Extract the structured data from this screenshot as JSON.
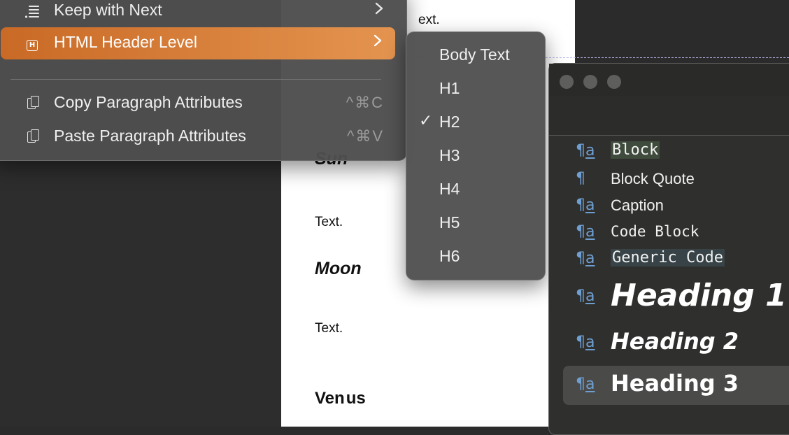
{
  "menu": {
    "items": [
      {
        "label": "Keep with Next",
        "icon": "paragraph-lines-icon",
        "has_submenu": true
      },
      {
        "label": "HTML Header Level",
        "icon": "h-badge-icon",
        "has_submenu": true,
        "highlighted": true
      },
      {
        "label": "Copy Paragraph Attributes",
        "icon": "copy-doc-icon",
        "shortcut": "^⌘C"
      },
      {
        "label": "Paste Paragraph Attributes",
        "icon": "paste-doc-icon",
        "shortcut": "^⌘V"
      }
    ],
    "highlight_color": "#d8792f"
  },
  "submenu": {
    "items": [
      {
        "label": "Body Text",
        "checked": false
      },
      {
        "label": "H1",
        "checked": false
      },
      {
        "label": "H2",
        "checked": true
      },
      {
        "label": "H3",
        "checked": false
      },
      {
        "label": "H4",
        "checked": false
      },
      {
        "label": "H5",
        "checked": false
      },
      {
        "label": "H6",
        "checked": false
      }
    ],
    "check_glyph": "✓"
  },
  "document": {
    "top_fragment": "ext.",
    "headings": [
      "Sun",
      "Moon",
      "Venus"
    ],
    "body_texts": [
      "Text.",
      "Text."
    ],
    "caret_color": "#e08a2c"
  },
  "styles_panel": {
    "styles": [
      {
        "name": "Block",
        "glyph": "¶a"
      },
      {
        "name": "Block Quote",
        "glyph": "¶"
      },
      {
        "name": "Caption",
        "glyph": "¶a"
      },
      {
        "name": "Code Block",
        "glyph": "¶a"
      },
      {
        "name": "Generic Code",
        "glyph": "¶a"
      },
      {
        "name": "Heading 1",
        "glyph": "¶a"
      },
      {
        "name": "Heading 2",
        "glyph": "¶a"
      },
      {
        "name": "Heading 3",
        "glyph": "¶a",
        "selected": true
      }
    ],
    "glyph_color": "#6f9ed0"
  }
}
